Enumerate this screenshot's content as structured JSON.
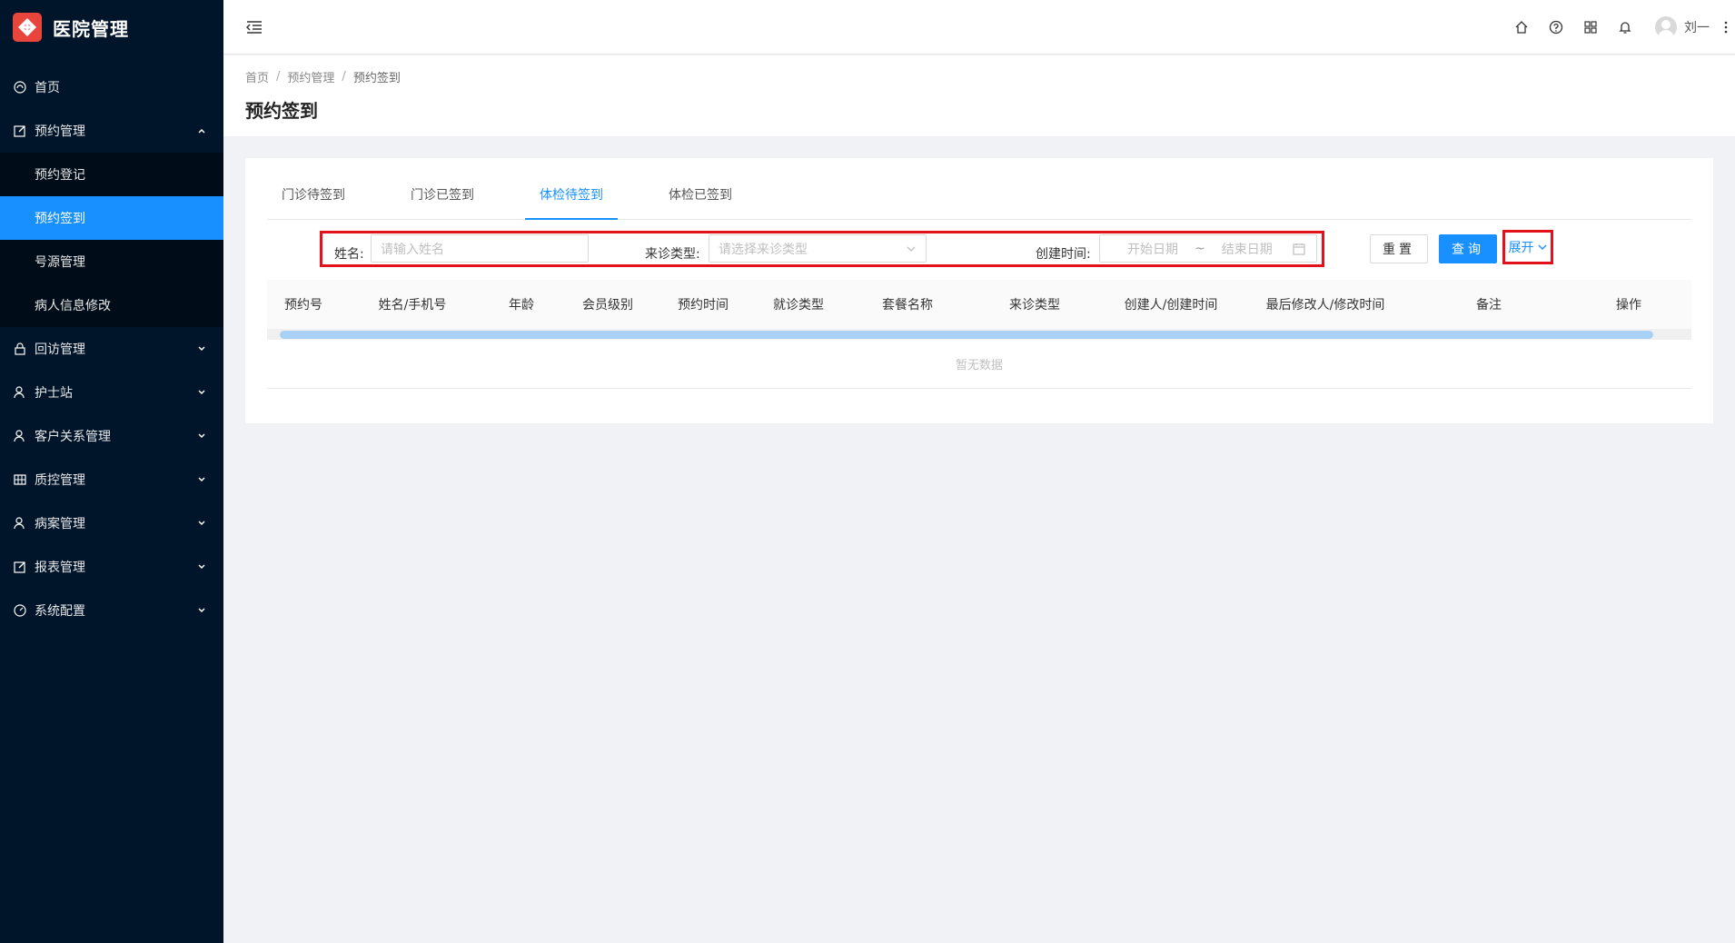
{
  "app": {
    "title": "医院管理",
    "logo_icon": "hospital-logo-icon",
    "brand_color": "#e8453c"
  },
  "sidebar": {
    "items": [
      {
        "label": "首页",
        "icon": "dashboard-icon",
        "expandable": false
      },
      {
        "label": "预约管理",
        "icon": "edit-icon",
        "expandable": true,
        "expanded": true,
        "children": [
          {
            "label": "预约登记",
            "active": false
          },
          {
            "label": "预约签到",
            "active": true
          },
          {
            "label": "号源管理",
            "active": false
          },
          {
            "label": "病人信息修改",
            "active": false
          }
        ]
      },
      {
        "label": "回访管理",
        "icon": "lock-icon",
        "expandable": true
      },
      {
        "label": "护士站",
        "icon": "user-icon",
        "expandable": true
      },
      {
        "label": "客户关系管理",
        "icon": "user-icon",
        "expandable": true
      },
      {
        "label": "质控管理",
        "icon": "table-icon",
        "expandable": true
      },
      {
        "label": "病案管理",
        "icon": "user-icon",
        "expandable": true
      },
      {
        "label": "报表管理",
        "icon": "edit-icon",
        "expandable": true
      },
      {
        "label": "系统配置",
        "icon": "dashboard-icon",
        "expandable": true
      }
    ],
    "active_color": "#1890ff"
  },
  "header": {
    "icons": [
      "home-icon",
      "help-icon",
      "apps-icon",
      "bell-icon"
    ],
    "user_name": "刘一"
  },
  "breadcrumb": [
    "首页",
    "预约管理",
    "预约签到"
  ],
  "page_title": "预约签到",
  "tabs": [
    {
      "label": "门诊待签到",
      "active": false
    },
    {
      "label": "门诊已签到",
      "active": false
    },
    {
      "label": "体检待签到",
      "active": true
    },
    {
      "label": "体检已签到",
      "active": false
    }
  ],
  "filters": {
    "name_label": "姓名:",
    "name_placeholder": "请输入姓名",
    "visit_type_label": "来诊类型:",
    "visit_type_placeholder": "请选择来诊类型",
    "created_label": "创建时间:",
    "start_placeholder": "开始日期",
    "range_sep": "~",
    "end_placeholder": "结束日期"
  },
  "buttons": {
    "reset": "重置",
    "query": "查询",
    "expand": "展开"
  },
  "table": {
    "columns": [
      "预约号",
      "姓名/手机号",
      "年龄",
      "会员级别",
      "预约时间",
      "就诊类型",
      "套餐名称",
      "来诊类型",
      "创建人/创建时间",
      "最后修改人/修改时间",
      "备注",
      "操作"
    ],
    "empty_text": "暂无数据"
  }
}
